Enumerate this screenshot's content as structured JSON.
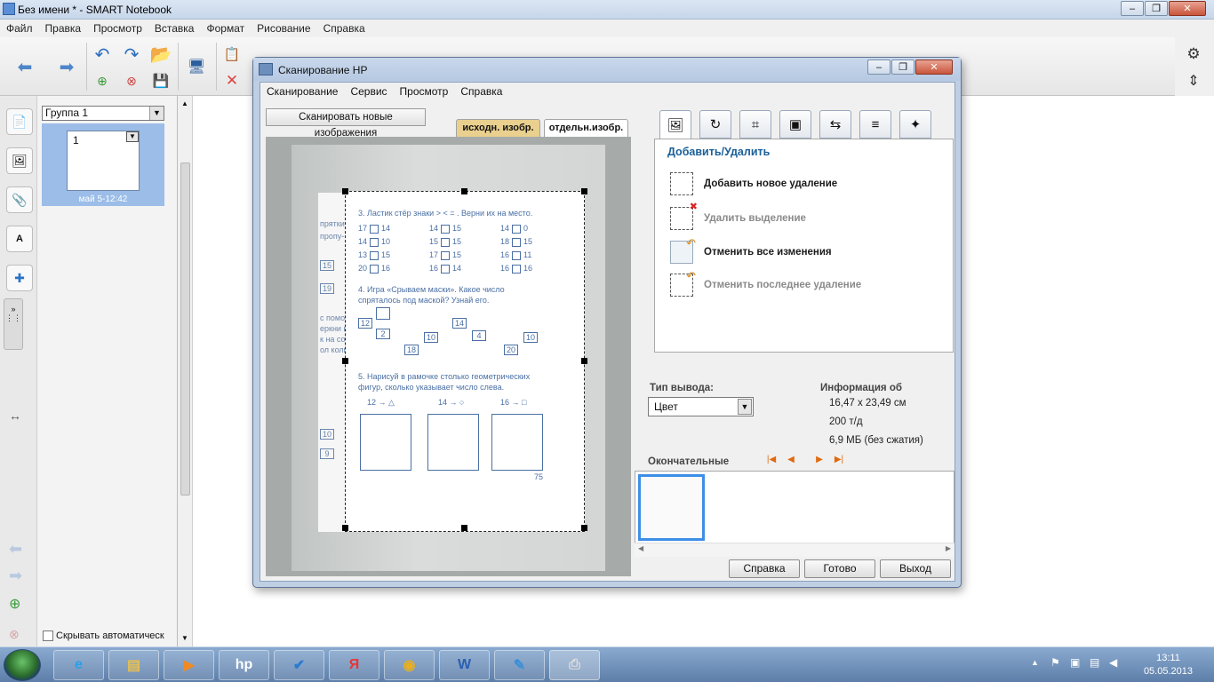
{
  "app": {
    "title": "Без имени * - SMART Notebook",
    "menu": [
      "Файл",
      "Правка",
      "Просмотр",
      "Вставка",
      "Формат",
      "Рисование",
      "Справка"
    ]
  },
  "sorter": {
    "group": "Группа 1",
    "page_number": "1",
    "page_date": "май 5-12:42",
    "autohide_label": "Скрывать автоматическ"
  },
  "dialog": {
    "title": "Сканирование HP",
    "menu": [
      "Сканирование",
      "Сервис",
      "Просмотр",
      "Справка"
    ],
    "scan_button": "Сканировать новые изображения",
    "preview_tabs": [
      "исходн. изобр.",
      "отдельн.изобр."
    ],
    "panel_header": "Добавить/Удалить",
    "actions": [
      {
        "label": "Добавить новое удаление",
        "enabled": true
      },
      {
        "label": "Удалить выделение",
        "enabled": false
      },
      {
        "label": "Отменить все изменения",
        "enabled": true
      },
      {
        "label": "Отменить последнее удаление",
        "enabled": false
      }
    ],
    "output_type_label": "Тип вывода:",
    "output_type_value": "Цвет",
    "info_title": "Информация об",
    "info_size": "16,47 x 23,49 см",
    "info_dpi": "200 т/д",
    "info_filesize": "6,9 МБ (без сжатия)",
    "final_label": "Окончательные",
    "buttons": {
      "help": "Справка",
      "done": "Готово",
      "exit": "Выход"
    }
  },
  "document": {
    "task3": "3. Ластик стёр знаки  > < = . Верни их на место.",
    "rows": [
      [
        "17",
        "14",
        "14",
        "15",
        "14",
        "0"
      ],
      [
        "14",
        "10",
        "15",
        "15",
        "18",
        "15"
      ],
      [
        "13",
        "15",
        "17",
        "15",
        "16",
        "11"
      ],
      [
        "20",
        "16",
        "16",
        "14",
        "16",
        "16"
      ]
    ],
    "task4": "4. Игра «Срываем маски». Какое число спряталось под маской? Узнай его.",
    "task4_numbers": [
      "12",
      "2",
      "18",
      "10",
      "14",
      "4",
      "20",
      "10"
    ],
    "task5": "5. Нарисуй в рамочке столько геометрических фигур, сколько указывает число слева.",
    "task5_numbers": [
      "12",
      "14",
      "16"
    ],
    "page_number": "75",
    "left_fragments": [
      "прятки.",
      "пропу-",
      "15",
      "19",
      "с помо-",
      "еркни в",
      "к на со",
      "ол коли-",
      "10",
      "9"
    ]
  },
  "taskbar": {
    "time": "13:11",
    "date": "05.05.2013"
  }
}
